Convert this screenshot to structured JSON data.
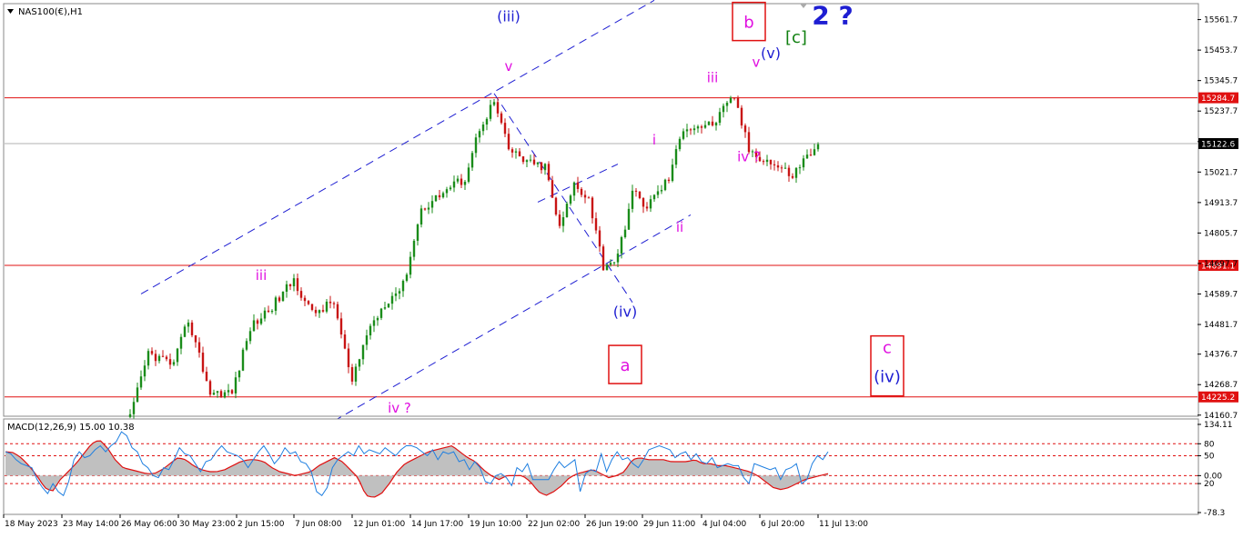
{
  "window": {
    "symbol_title": "NAS100(€),H1",
    "indicator_title": "MACD(12,26,9) 15.00 10.38"
  },
  "colors": {
    "background": "#ffffff",
    "bull_candle": "#1a8c1a",
    "bear_candle": "#c81414",
    "level_line": "#e01010",
    "current_price_line": "#b0b0b0",
    "channel": "#1e1ed2",
    "magenta_label": "#e010e0",
    "blue_label": "#1e1ed2",
    "green_label": "#108010",
    "box_border": "#e01010",
    "macd_hist": "#c0c0c0",
    "macd_line": "#1f7fe0",
    "signal_line": "#e01010"
  },
  "chart_data": [
    {
      "type": "candlestick",
      "title": "NAS100(€),H1",
      "ylim": [
        14160.0,
        15615.0
      ],
      "y_ticks": [
        "15561.7",
        "15453.7",
        "15345.7",
        "15237.7",
        "15129.7",
        "15021.7",
        "14913.7",
        "14805.7",
        "14697.7",
        "14589.7",
        "14481.7",
        "14376.7",
        "14268.7",
        "14160.7"
      ],
      "x_tick_labels": [
        "18 May 2023",
        "23 May 14:00",
        "26 May 06:00",
        "30 May 23:00",
        "2 Jun 15:00",
        "7 Jun 08:00",
        "12 Jun 01:00",
        "14 Jun 17:00",
        "19 Jun 10:00",
        "22 Jun 02:00",
        "26 Jun 19:00",
        "29 Jun 11:00",
        "4 Jul 04:00",
        "6 Jul 20:00",
        "11 Jul 13:00"
      ],
      "horizontal_levels": [
        {
          "value": 15284.7,
          "label": "15284.7",
          "style": "red-line"
        },
        {
          "value": 15122.6,
          "label": "15122.6",
          "style": "current-price"
        },
        {
          "value": 14691.1,
          "label": "14691.1",
          "style": "red-line"
        },
        {
          "value": 14225.2,
          "label": "14225.2",
          "style": "red-line"
        }
      ],
      "price_path": [
        {
          "bar": 0,
          "price": 14150
        },
        {
          "bar": 5,
          "price": 14380
        },
        {
          "bar": 12,
          "price": 14340
        },
        {
          "bar": 16,
          "price": 14500
        },
        {
          "bar": 22,
          "price": 14240
        },
        {
          "bar": 28,
          "price": 14240
        },
        {
          "bar": 33,
          "price": 14470
        },
        {
          "bar": 40,
          "price": 14560
        },
        {
          "bar": 45,
          "price": 14640
        },
        {
          "bar": 50,
          "price": 14520
        },
        {
          "bar": 56,
          "price": 14560
        },
        {
          "bar": 61,
          "price": 14270
        },
        {
          "bar": 65,
          "price": 14450
        },
        {
          "bar": 70,
          "price": 14560
        },
        {
          "bar": 75,
          "price": 14620
        },
        {
          "bar": 80,
          "price": 14890
        },
        {
          "bar": 87,
          "price": 14960
        },
        {
          "bar": 92,
          "price": 15000
        },
        {
          "bar": 96,
          "price": 15180
        },
        {
          "bar": 100,
          "price": 15270
        },
        {
          "bar": 104,
          "price": 15100
        },
        {
          "bar": 110,
          "price": 15050
        },
        {
          "bar": 114,
          "price": 15040
        },
        {
          "bar": 118,
          "price": 14820
        },
        {
          "bar": 122,
          "price": 14980
        },
        {
          "bar": 126,
          "price": 14930
        },
        {
          "bar": 130,
          "price": 14690
        },
        {
          "bar": 134,
          "price": 14720
        },
        {
          "bar": 138,
          "price": 14950
        },
        {
          "bar": 142,
          "price": 14900
        },
        {
          "bar": 148,
          "price": 15000
        },
        {
          "bar": 152,
          "price": 15180
        },
        {
          "bar": 160,
          "price": 15190
        },
        {
          "bar": 166,
          "price": 15290
        },
        {
          "bar": 170,
          "price": 15100
        },
        {
          "bar": 174,
          "price": 15070
        },
        {
          "bar": 178,
          "price": 15040
        },
        {
          "bar": 182,
          "price": 15010
        },
        {
          "bar": 186,
          "price": 15080
        },
        {
          "bar": 189,
          "price": 15120
        }
      ],
      "channel_lines": [
        {
          "from": {
            "bar": 3,
            "price": 14590
          },
          "to": {
            "bar": 144,
            "price": 15630
          }
        },
        {
          "from": {
            "bar": 56,
            "price": 14140
          },
          "to": {
            "bar": 154,
            "price": 14870
          }
        },
        {
          "from": {
            "bar": 100,
            "price": 15300
          },
          "to": {
            "bar": 138,
            "price": 14560
          }
        },
        {
          "from": {
            "bar": 112,
            "price": 14915
          },
          "to": {
            "bar": 134,
            "price": 15050
          }
        }
      ],
      "wave_labels": [
        {
          "text": "(iii)",
          "bar": 104,
          "price": 15555,
          "color": "blue",
          "size": 16
        },
        {
          "text": "v",
          "bar": 104,
          "price": 15380,
          "color": "magenta",
          "size": 15
        },
        {
          "text": "iii",
          "bar": 36,
          "price": 14640,
          "color": "magenta",
          "size": 15
        },
        {
          "text": "iv ?",
          "bar": 74,
          "price": 14170,
          "color": "magenta",
          "size": 15
        },
        {
          "text": "i",
          "bar": 144,
          "price": 15120,
          "color": "magenta",
          "size": 15
        },
        {
          "text": "ii",
          "bar": 151,
          "price": 14810,
          "color": "magenta",
          "size": 15
        },
        {
          "text": "(iv)",
          "bar": 136,
          "price": 14510,
          "color": "blue",
          "size": 16
        },
        {
          "text": "iii",
          "bar": 160,
          "price": 15340,
          "color": "magenta",
          "size": 15
        },
        {
          "text": "v",
          "bar": 172,
          "price": 15395,
          "color": "magenta",
          "size": 15
        },
        {
          "text": "(v)",
          "bar": 176,
          "price": 15425,
          "color": "blue",
          "size": 16
        },
        {
          "text": "iv ?",
          "bar": 170,
          "price": 15060,
          "color": "magenta",
          "size": 15
        },
        {
          "text": "[c]",
          "bar": 183,
          "price": 15480,
          "color": "green",
          "size": 18
        },
        {
          "text": "2 ?",
          "bar": 193,
          "price": 15545,
          "color": "blue",
          "size": 28
        }
      ],
      "boxed_labels": [
        {
          "lines": [
            {
              "text": "b",
              "color": "magenta"
            }
          ],
          "bar": 170,
          "price": 15555
        },
        {
          "lines": [
            {
              "text": "a",
              "color": "magenta"
            }
          ],
          "bar": 136,
          "price": 14340
        },
        {
          "lines": [
            {
              "text": "c",
              "color": "magenta"
            },
            {
              "text": "(iv)",
              "color": "blue"
            }
          ],
          "bar": 208,
          "price": 14335
        }
      ]
    },
    {
      "type": "line",
      "title": "MACD(12,26,9) 15.00 10.38",
      "ylim": [
        -95,
        140
      ],
      "y_ticks": [
        "134.11",
        "80",
        "50",
        "0.00",
        "20",
        "-78.3"
      ],
      "levels": [
        80,
        50,
        0,
        -20
      ],
      "series": [
        {
          "name": "main",
          "values": [
            60,
            55,
            40,
            30,
            25,
            20,
            -10,
            -30,
            -45,
            -20,
            -40,
            -50,
            -15,
            40,
            60,
            45,
            50,
            65,
            75,
            60,
            75,
            85,
            110,
            100,
            70,
            60,
            30,
            20,
            0,
            -5,
            20,
            15,
            40,
            70,
            55,
            50,
            30,
            10,
            35,
            40,
            60,
            75,
            60,
            55,
            50,
            40,
            20,
            40,
            60,
            75,
            55,
            30,
            45,
            70,
            55,
            60,
            35,
            30,
            10,
            -40,
            -50,
            -30,
            20,
            40,
            50,
            60,
            50,
            75,
            55,
            65,
            60,
            55,
            70,
            60,
            50,
            65,
            75,
            75,
            70,
            60,
            50,
            65,
            40,
            60,
            55,
            60,
            35,
            40,
            15,
            35,
            20,
            -15,
            -20,
            0,
            5,
            -5,
            -25,
            20,
            10,
            30,
            -10,
            -10,
            -10,
            -10,
            15,
            35,
            20,
            30,
            40,
            -40,
            5,
            15,
            10,
            55,
            10,
            40,
            60,
            40,
            45,
            30,
            20,
            40,
            65,
            70,
            75,
            70,
            65,
            45,
            55,
            60,
            40,
            55,
            35,
            30,
            45,
            20,
            25,
            30,
            25,
            25,
            -5,
            -20,
            30,
            25,
            20,
            15,
            20,
            -10,
            15,
            20,
            30,
            -20,
            -10,
            30,
            50,
            40,
            60
          ]
        },
        {
          "name": "signal",
          "values": [
            60,
            58,
            45,
            25,
            0,
            -30,
            -40,
            -10,
            10,
            30,
            55,
            80,
            90,
            70,
            40,
            20,
            15,
            10,
            5,
            5,
            15,
            30,
            45,
            40,
            25,
            15,
            10,
            10,
            15,
            25,
            35,
            40,
            40,
            35,
            20,
            10,
            5,
            0,
            5,
            10,
            25,
            35,
            45,
            35,
            15,
            -5,
            -50,
            -55,
            -45,
            -20,
            10,
            30,
            40,
            50,
            60,
            65,
            70,
            75,
            60,
            45,
            35,
            15,
            0,
            -10,
            0,
            0,
            0,
            -15,
            -40,
            -50,
            -40,
            -25,
            -5,
            5,
            10,
            15,
            5,
            -5,
            0,
            10,
            40,
            45,
            40,
            40,
            40,
            35,
            35,
            35,
            40,
            30,
            30,
            25,
            25,
            20,
            15,
            10,
            0,
            -15,
            -30,
            -35,
            -30,
            -20,
            -10,
            -5,
            0,
            5
          ]
        }
      ]
    }
  ]
}
